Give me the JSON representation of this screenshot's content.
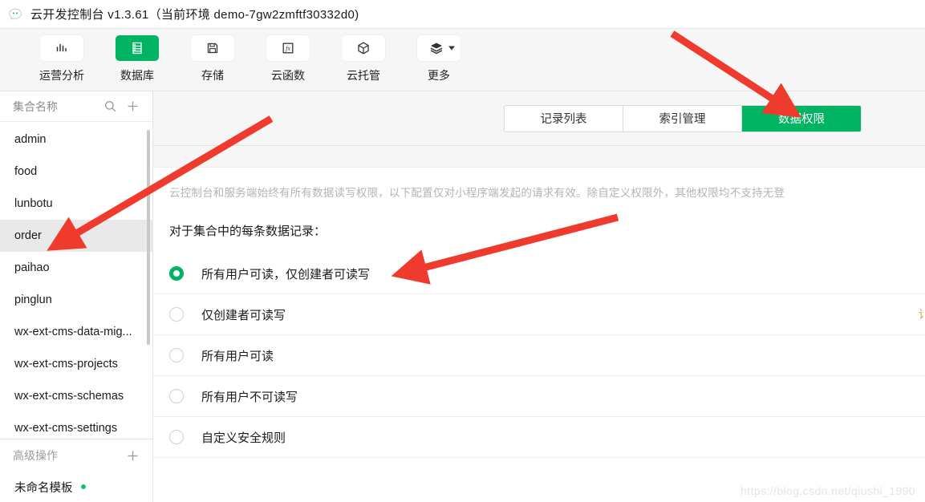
{
  "window": {
    "title": "云开发控制台 v1.3.61（当前环境 demo-7gw2zmftf30332d0)",
    "logo_icon": "wechat-cloud-logo-icon"
  },
  "toolbar": {
    "items": [
      {
        "label": "运营分析",
        "icon": "bar-chart-icon",
        "active": false
      },
      {
        "label": "数据库",
        "icon": "database-icon",
        "active": true
      },
      {
        "label": "存储",
        "icon": "floppy-disk-icon",
        "active": false
      },
      {
        "label": "云函数",
        "icon": "fx-function-icon",
        "active": false
      },
      {
        "label": "云托管",
        "icon": "cube-icon",
        "active": false
      },
      {
        "label": "更多",
        "icon": "layers-icon",
        "active": false,
        "has_dropdown": true
      }
    ]
  },
  "sidebar": {
    "header_title": "集合名称",
    "search_icon": "search-icon",
    "add_icon": "plus-icon",
    "collections": [
      {
        "name": "admin",
        "selected": false
      },
      {
        "name": "food",
        "selected": false
      },
      {
        "name": "lunbotu",
        "selected": false
      },
      {
        "name": "order",
        "selected": true
      },
      {
        "name": "paihao",
        "selected": false
      },
      {
        "name": "pinglun",
        "selected": false
      },
      {
        "name": "wx-ext-cms-data-mig...",
        "selected": false
      },
      {
        "name": "wx-ext-cms-projects",
        "selected": false
      },
      {
        "name": "wx-ext-cms-schemas",
        "selected": false
      },
      {
        "name": "wx-ext-cms-settings",
        "selected": false
      }
    ],
    "advanced": {
      "title": "高级操作",
      "add_icon": "plus-icon",
      "template_name": "未命名模板",
      "template_status_color": "#14c26a"
    }
  },
  "main": {
    "tabs": [
      {
        "label": "记录列表",
        "active": false
      },
      {
        "label": "索引管理",
        "active": false
      },
      {
        "label": "数据权限",
        "active": true
      }
    ],
    "description": "云控制台和服务端始终有所有数据读写权限，以下配置仅对小程序端发起的请求有效。除自定义权限外，其他权限均不支持无登",
    "question": "对于集合中的每条数据记录：",
    "permissions": [
      {
        "label": "所有用户可读，仅创建者可读写",
        "checked": true
      },
      {
        "label": "仅创建者可读写",
        "checked": false
      },
      {
        "label": "所有用户可读",
        "checked": false
      },
      {
        "label": "所有用户不可读写",
        "checked": false
      },
      {
        "label": "自定义安全规则",
        "checked": false
      }
    ]
  },
  "watermark": {
    "text": "https://blog.csdn.net/qiushi_1990"
  },
  "colors": {
    "accent_green": "#00b464",
    "annotation_red": "#ef3b2d",
    "selected_row": "#e9e9e9"
  }
}
